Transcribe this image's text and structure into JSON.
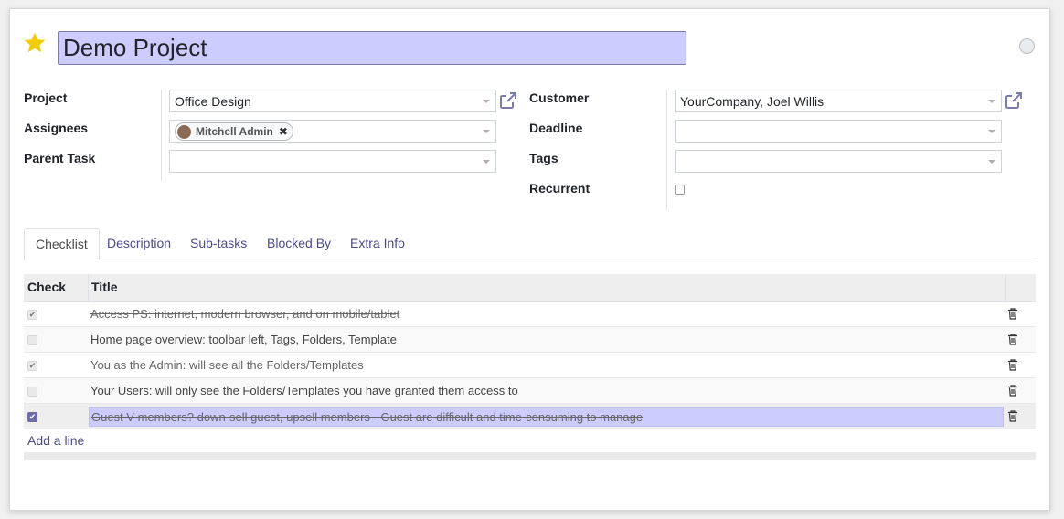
{
  "record": {
    "title": "Demo Project",
    "starred": true
  },
  "colors": {
    "star": "#f3cc00",
    "accent": "#7c7bad",
    "highlight": "#ccccff"
  },
  "left_fields": {
    "project_label": "Project",
    "project_value": "Office Design",
    "assignees_label": "Assignees",
    "assignee_tag": "Mitchell Admin",
    "parent_task_label": "Parent Task",
    "parent_task_value": ""
  },
  "right_fields": {
    "customer_label": "Customer",
    "customer_value": "YourCompany, Joel Willis",
    "deadline_label": "Deadline",
    "deadline_value": "",
    "tags_label": "Tags",
    "tags_value": "",
    "recurrent_label": "Recurrent",
    "recurrent_checked": false
  },
  "tabs": [
    {
      "label": "Checklist",
      "active": true
    },
    {
      "label": "Description",
      "active": false
    },
    {
      "label": "Sub-tasks",
      "active": false
    },
    {
      "label": "Blocked By",
      "active": false
    },
    {
      "label": "Extra Info",
      "active": false
    }
  ],
  "checklist": {
    "columns": [
      "Check",
      "Title"
    ],
    "rows": [
      {
        "checked": true,
        "title": "Access PS: internet, modern browser, and on mobile/tablet"
      },
      {
        "checked": false,
        "title": "Home page overview: toolbar left, Tags, Folders, Template"
      },
      {
        "checked": true,
        "title": "You as the Admin: will see all the Folders/Templates"
      },
      {
        "checked": false,
        "title": "Your Users: will only see the Folders/Templates you have granted them access to"
      },
      {
        "checked": true,
        "title": "Guest V members? down-sell guest, upsell members - Guest are difficult and time-consuming to manage",
        "selected": true
      }
    ],
    "add_line": "Add a line"
  }
}
